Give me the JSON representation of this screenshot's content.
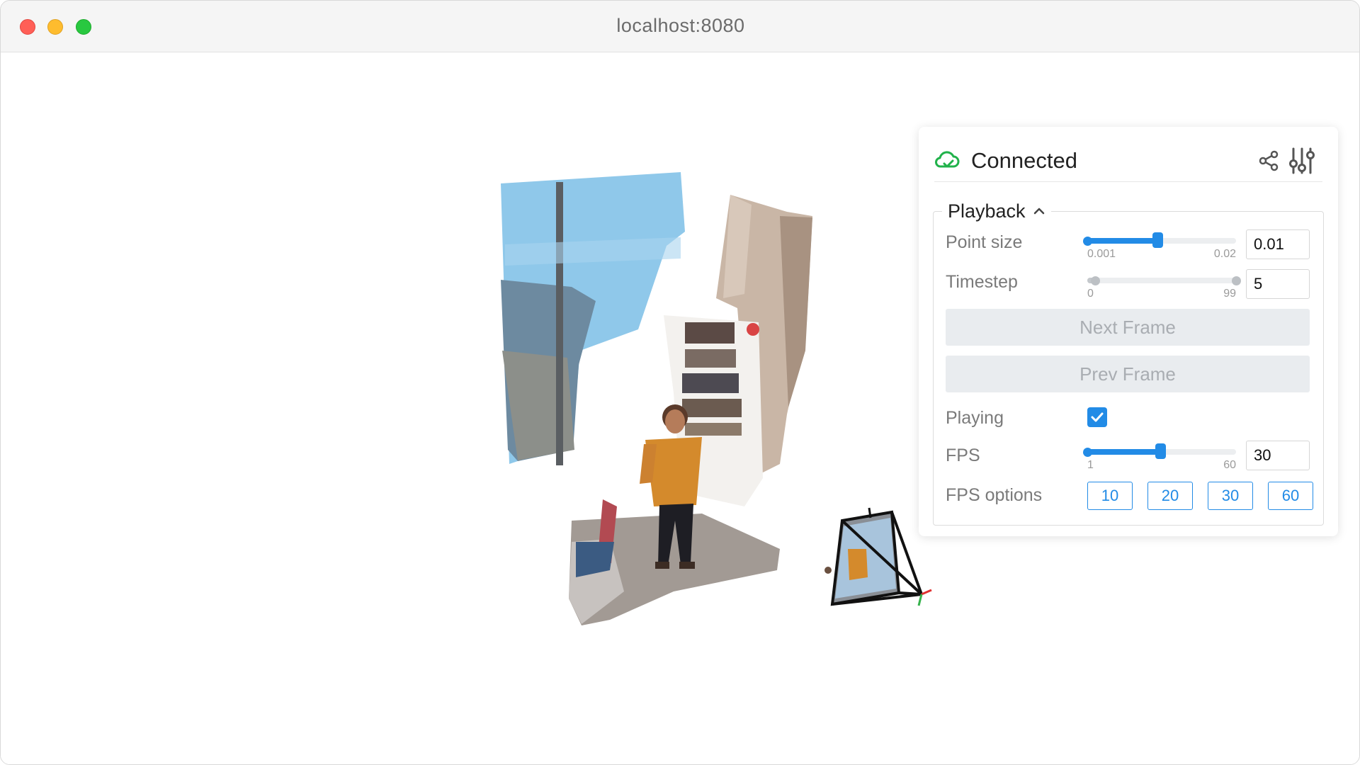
{
  "window": {
    "title": "localhost:8080"
  },
  "status": {
    "text": "Connected",
    "color": "#21b24b"
  },
  "icons": {
    "status": "cloud-check-icon",
    "share": "share-icon",
    "settings": "sliders-icon"
  },
  "playback": {
    "title": "Playback",
    "point_size": {
      "label": "Point size",
      "min": "0.001",
      "max": "0.02",
      "value": "0.01",
      "fraction": 0.47
    },
    "timestep": {
      "label": "Timestep",
      "min": "0",
      "max": "99",
      "value": "5",
      "fraction": 0.05
    },
    "next_frame": "Next Frame",
    "prev_frame": "Prev Frame",
    "playing": {
      "label": "Playing",
      "checked": true
    },
    "fps": {
      "label": "FPS",
      "min": "1",
      "max": "60",
      "value": "30",
      "fraction": 0.49
    },
    "fps_options": {
      "label": "FPS options",
      "options": [
        "10",
        "20",
        "30",
        "60"
      ]
    }
  },
  "accent_color": "#228be6"
}
